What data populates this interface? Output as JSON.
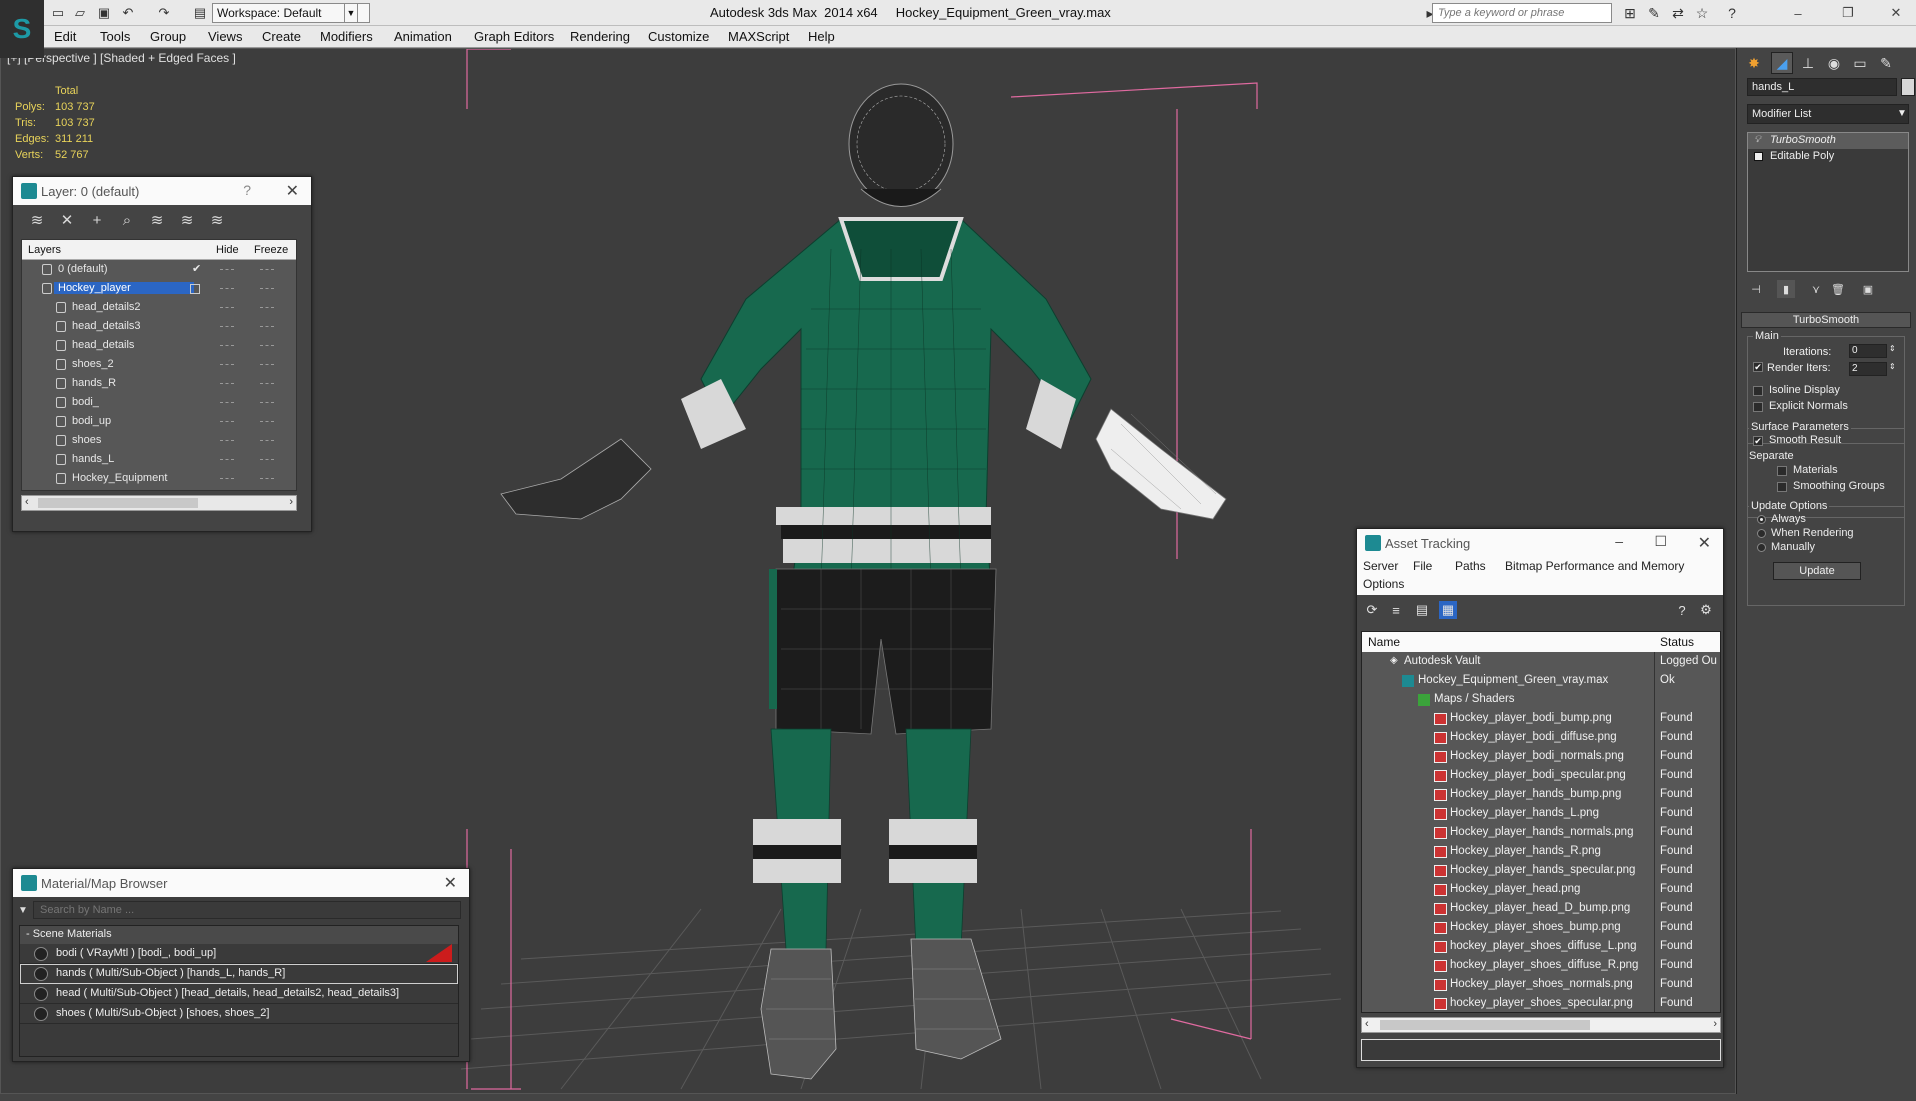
{
  "window": {
    "title": "Autodesk 3ds Max  2014 x64     Hockey_Equipment_Green_vray.max",
    "workspace": "Workspace: Default",
    "search_placeholder": "Type a keyword or phrase"
  },
  "menu": [
    "Edit",
    "Tools",
    "Group",
    "Views",
    "Create",
    "Modifiers",
    "Animation",
    "Graph Editors",
    "Rendering",
    "Customize",
    "MAXScript",
    "Help"
  ],
  "viewport": {
    "label": "[+] [Perspective ] [Shaded + Edged Faces ]",
    "stats": {
      "header": "Total",
      "rows": [
        {
          "label": "Polys:",
          "value": "103 737"
        },
        {
          "label": "Tris:",
          "value": "103 737"
        },
        {
          "label": "Edges:",
          "value": "311 211"
        },
        {
          "label": "Verts:",
          "value": "52 767"
        }
      ]
    }
  },
  "layer_window": {
    "title": "Layer: 0 (default)",
    "help": "?",
    "columns": {
      "layers": "Layers",
      "hide": "Hide",
      "freeze": "Freeze"
    },
    "rows": [
      {
        "name": "0 (default)",
        "level": 0,
        "checked": true
      },
      {
        "name": "Hockey_player",
        "level": 0,
        "selected": true
      },
      {
        "name": "head_details2",
        "level": 1
      },
      {
        "name": "head_details3",
        "level": 1
      },
      {
        "name": "head_details",
        "level": 1
      },
      {
        "name": "shoes_2",
        "level": 1
      },
      {
        "name": "hands_R",
        "level": 1
      },
      {
        "name": "bodi_",
        "level": 1
      },
      {
        "name": "bodi_up",
        "level": 1
      },
      {
        "name": "shoes",
        "level": 1
      },
      {
        "name": "hands_L",
        "level": 1
      },
      {
        "name": "Hockey_Equipment",
        "level": 1
      }
    ]
  },
  "material_browser": {
    "title": "Material/Map Browser",
    "search_placeholder": "Search by Name ...",
    "group": "- Scene Materials",
    "items": [
      {
        "label": "bodi  ( VRayMtl ) [bodi_, bodi_up]",
        "selected": false,
        "flag": true
      },
      {
        "label": "hands  ( Multi/Sub-Object ) [hands_L, hands_R]",
        "selected": true
      },
      {
        "label": "head  ( Multi/Sub-Object ) [head_details, head_details2, head_details3]",
        "selected": false
      },
      {
        "label": "shoes  ( Multi/Sub-Object ) [shoes, shoes_2]",
        "selected": false
      }
    ]
  },
  "asset_tracking": {
    "title": "Asset Tracking",
    "menu_row1": [
      "Server",
      "File",
      "Paths",
      "Bitmap Performance and Memory"
    ],
    "menu_row2": [
      "Options"
    ],
    "columns": {
      "name": "Name",
      "status": "Status"
    },
    "rows": [
      {
        "name": "Autodesk Vault",
        "status": "Logged Ou",
        "level": 1,
        "icon": "vault"
      },
      {
        "name": "Hockey_Equipment_Green_vray.max",
        "status": "Ok",
        "level": 2,
        "icon": "max"
      },
      {
        "name": "Maps / Shaders",
        "status": "",
        "level": 3,
        "icon": "maps"
      },
      {
        "name": "Hockey_player_bodi_bump.png",
        "status": "Found",
        "level": 4,
        "icon": "png"
      },
      {
        "name": "Hockey_player_bodi_diffuse.png",
        "status": "Found",
        "level": 4,
        "icon": "png"
      },
      {
        "name": "Hockey_player_bodi_normals.png",
        "status": "Found",
        "level": 4,
        "icon": "png"
      },
      {
        "name": "Hockey_player_bodi_specular.png",
        "status": "Found",
        "level": 4,
        "icon": "png"
      },
      {
        "name": "Hockey_player_hands_bump.png",
        "status": "Found",
        "level": 4,
        "icon": "png"
      },
      {
        "name": "Hockey_player_hands_L.png",
        "status": "Found",
        "level": 4,
        "icon": "png"
      },
      {
        "name": "Hockey_player_hands_normals.png",
        "status": "Found",
        "level": 4,
        "icon": "png"
      },
      {
        "name": "Hockey_player_hands_R.png",
        "status": "Found",
        "level": 4,
        "icon": "png"
      },
      {
        "name": "Hockey_player_hands_specular.png",
        "status": "Found",
        "level": 4,
        "icon": "png"
      },
      {
        "name": "Hockey_player_head.png",
        "status": "Found",
        "level": 4,
        "icon": "png"
      },
      {
        "name": "Hockey_player_head_D_bump.png",
        "status": "Found",
        "level": 4,
        "icon": "png"
      },
      {
        "name": "Hockey_player_shoes_bump.png",
        "status": "Found",
        "level": 4,
        "icon": "png"
      },
      {
        "name": "hockey_player_shoes_diffuse_L.png",
        "status": "Found",
        "level": 4,
        "icon": "png"
      },
      {
        "name": "hockey_player_shoes_diffuse_R.png",
        "status": "Found",
        "level": 4,
        "icon": "png"
      },
      {
        "name": "Hockey_player_shoes_normals.png",
        "status": "Found",
        "level": 4,
        "icon": "png"
      },
      {
        "name": "hockey_player_shoes_specular.png",
        "status": "Found",
        "level": 4,
        "icon": "png"
      }
    ]
  },
  "command_panel": {
    "object_name": "hands_L",
    "modifier_list": "Modifier List",
    "stack": [
      {
        "label": "TurboSmooth",
        "selected": true
      },
      {
        "label": "Editable Poly",
        "selected": false
      }
    ],
    "rollout_title": "TurboSmooth",
    "main_group": "Main",
    "iterations_label": "Iterations:",
    "iterations_value": "0",
    "render_iters_label": "Render Iters:",
    "render_iters_value": "2",
    "render_iters_checked": true,
    "isoline_label": "Isoline Display",
    "explicit_label": "Explicit Normals",
    "surface_group": "Surface Parameters",
    "smooth_result_label": "Smooth Result",
    "separate_label": "Separate",
    "materials_label": "Materials",
    "smoothing_label": "Smoothing Groups",
    "update_group": "Update Options",
    "opt_always": "Always",
    "opt_when_rendering": "When Rendering",
    "opt_manually": "Manually",
    "update_button": "Update"
  },
  "colors": {
    "accent_blue": "#2b66c4",
    "jersey_green": "#17694e",
    "bounding_box": "#e06aa0",
    "stats_yellow": "#e8d35a"
  }
}
